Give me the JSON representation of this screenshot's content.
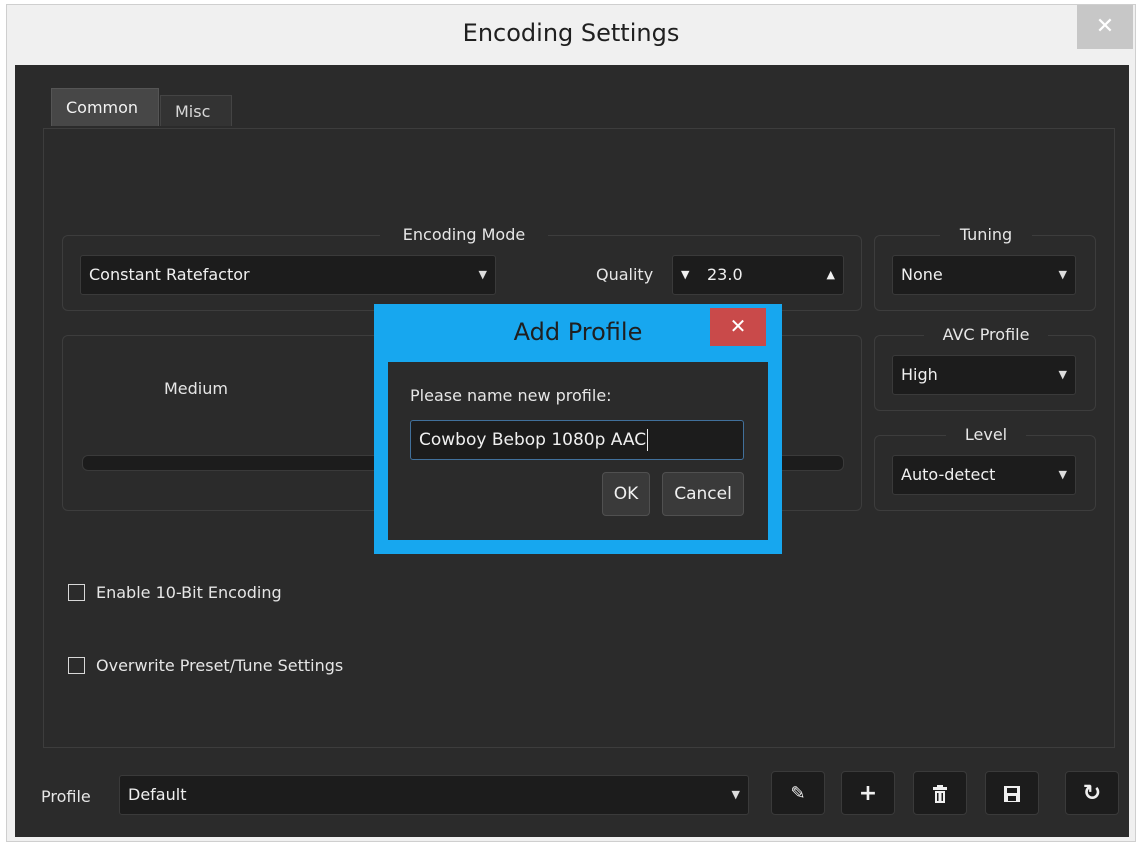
{
  "window": {
    "title": "Encoding Settings",
    "close_glyph": "✕"
  },
  "tabs": [
    {
      "label": "Common"
    },
    {
      "label": "Misc"
    }
  ],
  "encoding_mode": {
    "group_title": "Encoding Mode",
    "mode_value": "Constant Ratefactor",
    "quality_label": "Quality",
    "quality_value": "23.0"
  },
  "tuning": {
    "group_title": "Tuning",
    "value": "None"
  },
  "avc_profile": {
    "group_title": "AVC Profile",
    "value": "High"
  },
  "level": {
    "group_title": "Level",
    "value": "Auto-detect"
  },
  "preset": {
    "value_label": "Medium"
  },
  "checkboxes": {
    "enable_10bit": {
      "label": "Enable 10-Bit Encoding",
      "checked": false
    },
    "overwrite_preset": {
      "label": "Overwrite Preset/Tune Settings",
      "checked": false
    }
  },
  "profile_bar": {
    "label": "Profile",
    "value": "Default",
    "buttons": [
      {
        "icon": "edit-icon"
      },
      {
        "icon": "add-icon"
      },
      {
        "icon": "trash-icon"
      },
      {
        "icon": "save-icon"
      },
      {
        "icon": "reload-icon"
      }
    ]
  },
  "dialog": {
    "title": "Add Profile",
    "close_glyph": "✕",
    "prompt": "Please name new profile:",
    "input_value": "Cowboy Bebop 1080p AAC",
    "ok_label": "OK",
    "cancel_label": "Cancel"
  },
  "colors": {
    "accent": "#17a7ef",
    "dark_bg": "#2b2b2b",
    "close_red": "#c94a4a"
  }
}
